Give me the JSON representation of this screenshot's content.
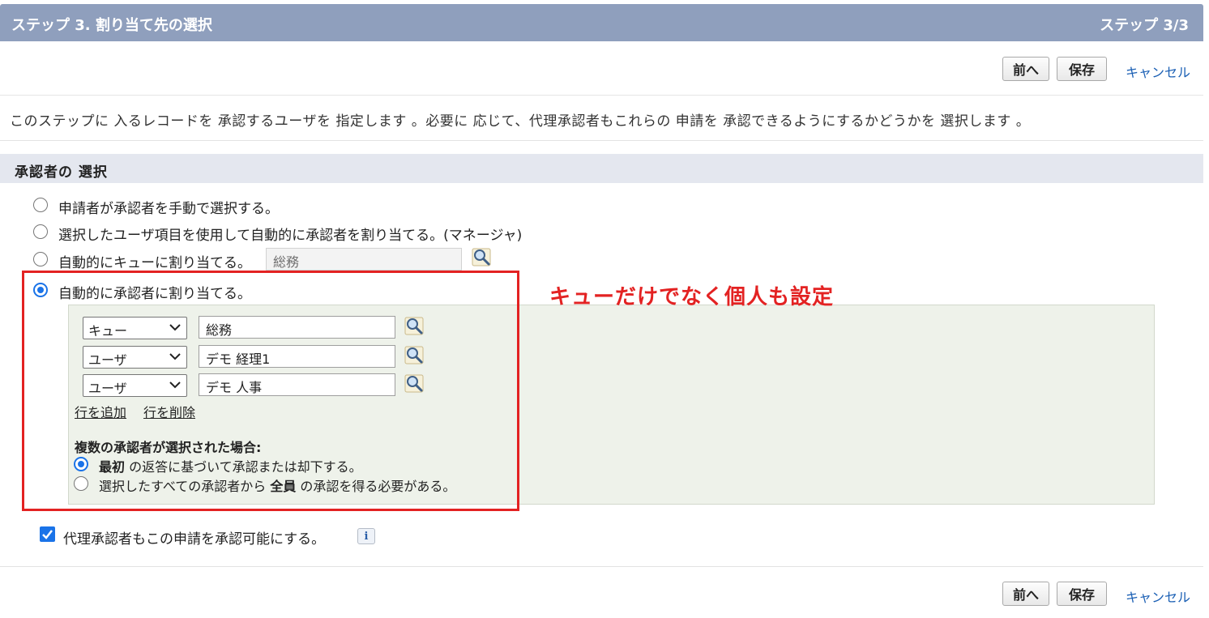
{
  "header": {
    "title": "ステップ 3. 割り当て先の選択",
    "step_indicator": "ステップ 3/3"
  },
  "toolbar": {
    "prev_label": "前へ",
    "save_label": "保存",
    "cancel_label": "キャンセル"
  },
  "description": "このステップに 入るレコードを 承認するユーザを 指定します 。必要に 応じて、代理承認者もこれらの 申請を 承認できるようにするかどうかを 選択します 。",
  "section": {
    "title": "承認者の 選択"
  },
  "approver_options": [
    {
      "label": "申請者が承認者を手動で選択する。",
      "selected": false
    },
    {
      "label": "選択したユーザ項目を使用して自動的に承認者を割り当てる。(マネージャ)",
      "selected": false
    },
    {
      "label": "自動的にキューに割り当てる。",
      "selected": false,
      "queue_value": "総務"
    },
    {
      "label": "自動的に承認者に割り当てる。",
      "selected": true
    }
  ],
  "approver_rows": [
    {
      "type": "キュー",
      "value": "総務"
    },
    {
      "type": "ユーザ",
      "value": "デモ 経理1"
    },
    {
      "type": "ユーザ",
      "value": "デモ 人事"
    }
  ],
  "row_actions": {
    "add_row": "行を追加",
    "delete_row": "行を削除"
  },
  "multi_approver": {
    "heading": "複数の承認者が選択された場合:",
    "options": [
      {
        "bold": "最初",
        "rest": " の返答に基づいて承認または却下する。",
        "selected": true
      },
      {
        "prefix": "選択したすべての承認者から ",
        "bold": "全員",
        "rest": " の承認を得る必要がある。",
        "selected": false
      }
    ]
  },
  "delegate": {
    "label": "代理承認者もこの申請を承認可能にする。",
    "checked": true,
    "info_icon": "info-icon"
  },
  "annotation": "キューだけでなく個人も設定",
  "colors": {
    "header_bg": "#8f9fbd",
    "section_bg": "#e4e7ef",
    "highlight_red": "#e32222",
    "accent_blue": "#1a73e8",
    "link_blue": "#1a5fb4",
    "panel_green": "#eef2ea"
  }
}
